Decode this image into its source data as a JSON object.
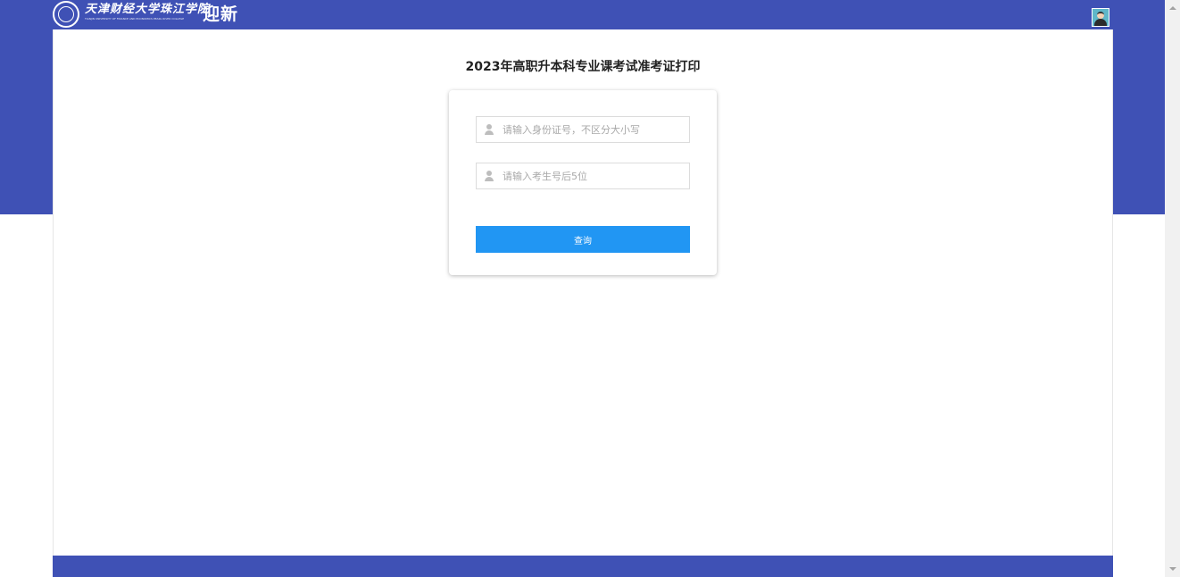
{
  "header": {
    "logo_text_cn": "天津财经大学珠江学院",
    "logo_text_en": "TIANJIN UNIVERSITY OF FINANCE AND ECONOMICS PEARL RIVER COLLEGE",
    "title": "迎新"
  },
  "main": {
    "page_title": "2023年高职升本科专业课考试准考证打印",
    "form": {
      "id_placeholder": "请输入身份证号，不区分大小写",
      "id_value": "",
      "exam_no_placeholder": "请输入考生号后5位",
      "exam_no_value": "",
      "submit_label": "查询"
    }
  },
  "icons": {
    "user_field_icon": "user-icon",
    "logo": "college-seal-icon",
    "avatar": "user-avatar-icon"
  },
  "colors": {
    "brand": "#3f51b5",
    "button": "#2196f3"
  }
}
